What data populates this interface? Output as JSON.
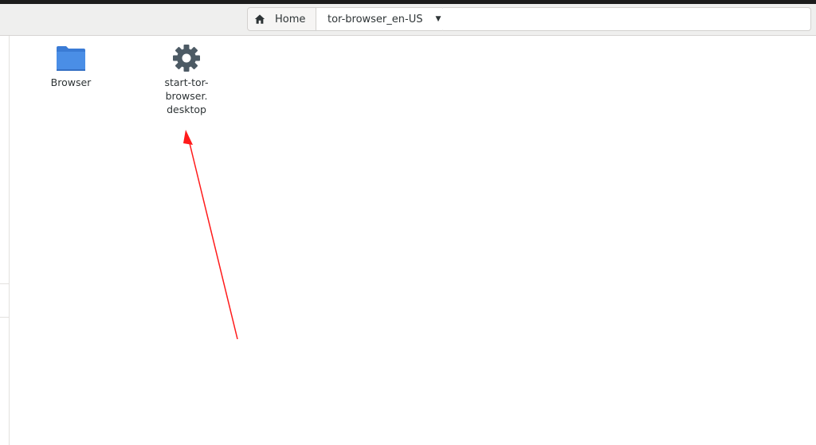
{
  "pathbar": {
    "home_label": "Home",
    "current_label": "tor-browser_en-US"
  },
  "files": [
    {
      "name": "Browser",
      "type": "folder",
      "icon": "folder-icon"
    },
    {
      "name": "start-tor-\nbrowser.\ndesktop",
      "type": "desktop-file",
      "icon": "gear-icon"
    }
  ],
  "colors": {
    "folder": "#4a8ee6",
    "gear": "#4c5a64",
    "annotation_arrow": "#ff0000"
  }
}
